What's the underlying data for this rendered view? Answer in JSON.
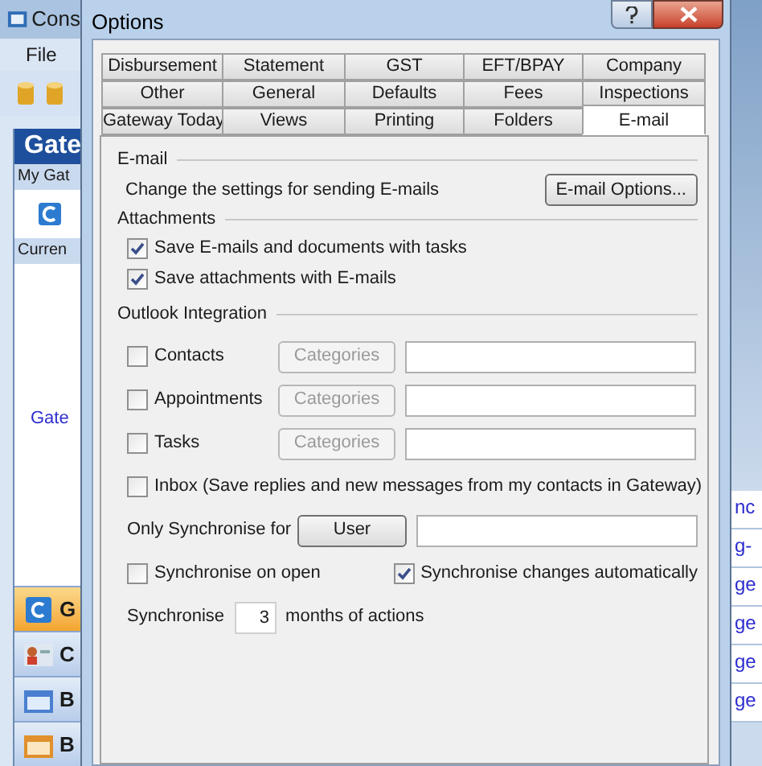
{
  "background_app": {
    "title": "Cons",
    "menu": [
      "File"
    ],
    "header": "Gate",
    "section_1": "My Gat",
    "section_2": "Curren",
    "link": "Gate",
    "nav_items": [
      {
        "label": "G",
        "selected": true
      },
      {
        "label": "C",
        "selected": false
      },
      {
        "label": "B",
        "selected": false
      },
      {
        "label": "B",
        "selected": false
      }
    ],
    "right_fragments": [
      "nc",
      "g-",
      "ge",
      "ge",
      "ge",
      "ge"
    ]
  },
  "dialog": {
    "title": "Options",
    "tab_rows": [
      [
        {
          "label": "Disbursement",
          "selected": false
        },
        {
          "label": "Statement",
          "selected": false
        },
        {
          "label": "GST",
          "selected": false
        },
        {
          "label": "EFT/BPAY",
          "selected": false
        },
        {
          "label": "Company",
          "selected": false
        }
      ],
      [
        {
          "label": "Other",
          "selected": false
        },
        {
          "label": "General",
          "selected": false
        },
        {
          "label": "Defaults",
          "selected": false
        },
        {
          "label": "Fees",
          "selected": false
        },
        {
          "label": "Inspections",
          "selected": false
        }
      ],
      [
        {
          "label": "Gateway Today",
          "selected": false
        },
        {
          "label": "Views",
          "selected": false
        },
        {
          "label": "Printing",
          "selected": false
        },
        {
          "label": "Folders",
          "selected": false
        },
        {
          "label": "E-mail",
          "selected": true
        }
      ]
    ],
    "email_section": {
      "heading": "E-mail",
      "description": "Change the settings for sending E-mails",
      "button": "E-mail Options..."
    },
    "attachments": {
      "heading": "Attachments",
      "options": [
        {
          "label": "Save E-mails and documents with tasks",
          "checked": true
        },
        {
          "label": "Save attachments with E-mails",
          "checked": true
        }
      ]
    },
    "outlook": {
      "heading": "Outlook Integration",
      "folders": [
        {
          "label": "Contacts",
          "checked": false,
          "button": "Categories",
          "disabled": true
        },
        {
          "label": "Appointments",
          "checked": false,
          "button": "Categories",
          "disabled": true
        },
        {
          "label": "Tasks",
          "checked": false,
          "button": "Categories",
          "disabled": true
        }
      ],
      "inbox": {
        "label": "Inbox (Save replies and new messages from my contacts in Gateway)",
        "checked": false
      },
      "only_sync": {
        "label": "Only Synchronise for",
        "button": "User"
      },
      "sync_on_open": {
        "label": "Synchronise on open",
        "checked": false
      },
      "sync_auto": {
        "label": "Synchronise changes automatically",
        "checked": true
      },
      "sync_period": {
        "label_before": "Synchronise",
        "value": "3",
        "label_after": "months of actions"
      }
    }
  }
}
